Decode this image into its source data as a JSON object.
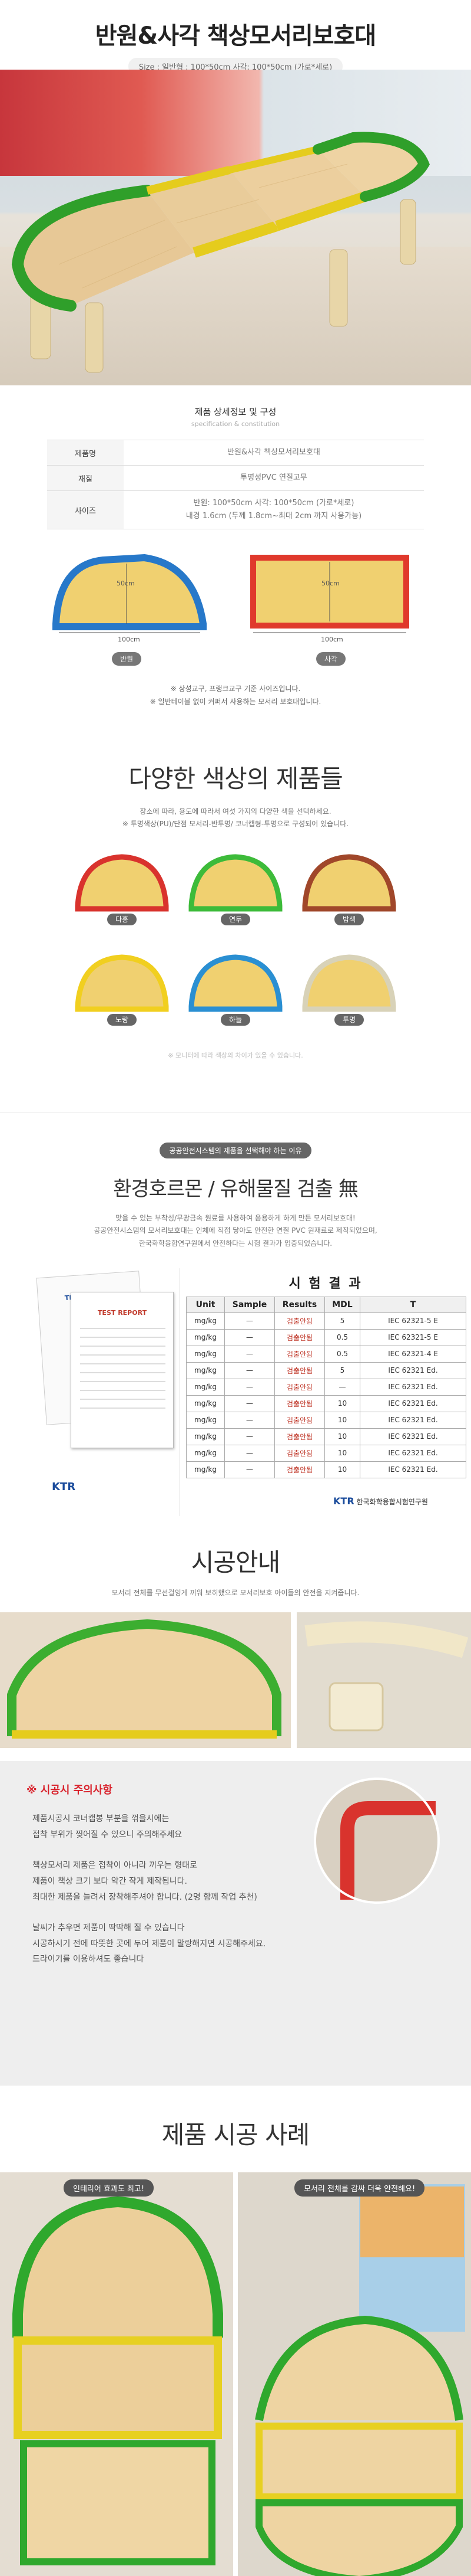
{
  "header": {
    "title": "반원&사각 책상모서리보호대",
    "size_note": "Size : 일반형 : 100*50cm 사각: 100*50cm (가로*세로)"
  },
  "spec": {
    "title": "제품 상세정보 및 구성",
    "subtitle": "specification & constitution",
    "rows": [
      {
        "key": "제품명",
        "value": "반원&사각 책상모서리보호대"
      },
      {
        "key": "재질",
        "value": "투명성PVC 연질고무"
      },
      {
        "key": "사이즈",
        "value": "반원: 100*50cm 사각: 100*50cm (가로*세로)",
        "value2": "내경 1.6cm (두께 1.8cm~최대 2cm 까지 사용가능)"
      }
    ],
    "dim_half_width": "100cm",
    "dim_half_height": "50cm",
    "dim_rect_width": "100cm",
    "dim_rect_height": "50cm",
    "label_half": "반원",
    "label_rect": "사각",
    "notes": [
      "※ 상성교구, 프랭크교구 기준 사이즈입니다.",
      "※ 일반테이블 없이 커퍼서 사용하는 모서리 보호대입니다."
    ]
  },
  "colors": {
    "heading": "다양한 색상의 제품들",
    "desc": [
      "장소에 따라, 용도에 따라서 여섯 가지의 다양한 색을 선택하세요.",
      "※ 투명색상(PU)/단점 모서리-반투명/ 코너캡형-투명으로 구성되어 있습니다."
    ],
    "items": [
      {
        "label": "다홍",
        "color": "#d9332d"
      },
      {
        "label": "연두",
        "color": "#3dbb3a"
      },
      {
        "label": "밤색",
        "color": "#a0472a"
      },
      {
        "label": "노랑",
        "color": "#f1cf1f"
      },
      {
        "label": "하늘",
        "color": "#2a8fd2"
      },
      {
        "label": "투명",
        "color": "#d8d2b8"
      }
    ],
    "foot": "※ 모니터에 따라 색상의 차이가 있을 수 있습니다."
  },
  "cert": {
    "pill": "공공안전시스템의 제품을 선택해야 하는 이유",
    "heading": "환경호르몬 / 유해물질 검출 無",
    "desc": [
      "맞을 수 있는 부착성/무광금속 원료를 사용하여 음용하게 하게 만든 모서리보호대!",
      "공공안전시스템의 모서리보호대는 인체에 직접 닿아도 안전한 연질 PVC 원재료로 제작되었으며,",
      "한국화학융합연구원에서 안전하다는 시험 결과가 입증되었습니다."
    ],
    "doc_title": "TEST REPORT",
    "doc_title2": "TEST REPORT",
    "ktr": "KTR",
    "ktr_org": "한국화학융합시험연구원",
    "report_title": "시 험 결 과",
    "columns": [
      "Unit",
      "Sample",
      "Results",
      "MDL",
      "T"
    ],
    "rows": [
      [
        "mg/kg",
        "—",
        "검출안됨",
        "5",
        "IEC 62321-5 E"
      ],
      [
        "mg/kg",
        "—",
        "검출안됨",
        "0.5",
        "IEC 62321-5 E"
      ],
      [
        "mg/kg",
        "—",
        "검출안됨",
        "0.5",
        "IEC 62321-4 E"
      ],
      [
        "mg/kg",
        "—",
        "검출안됨",
        "5",
        "IEC 62321 Ed."
      ],
      [
        "mg/kg",
        "—",
        "검출안됨",
        "—",
        "IEC 62321 Ed."
      ],
      [
        "mg/kg",
        "—",
        "검출안됨",
        "10",
        "IEC 62321 Ed."
      ],
      [
        "mg/kg",
        "—",
        "검출안됨",
        "10",
        "IEC 62321 Ed."
      ],
      [
        "mg/kg",
        "—",
        "검출안됨",
        "10",
        "IEC 62321 Ed."
      ],
      [
        "mg/kg",
        "—",
        "검출안됨",
        "10",
        "IEC 62321 Ed."
      ],
      [
        "mg/kg",
        "—",
        "검출안됨",
        "10",
        "IEC 62321 Ed."
      ]
    ]
  },
  "install": {
    "heading": "시공안내",
    "desc": "모서리 전체를 무선걸잉게 끼워 보히했으로 모서리보호 아이들의 안전을 지켜줍니다.",
    "caution_title": "※ 시공시 주의사항",
    "caution_lines": [
      "제품시공시 코너캡봉 부분을 꺾을시에는",
      "접착 부위가 찢어질 수 있으니 주의해주세요",
      "",
      "책상모서리 제품은 접착이 아니라 끼우는 형태로",
      "제품이 책상 크기 보다 약간 작게 제작됩니다.",
      "최대한 제품을 늘려서 장착해주셔야 합니다. (2명 함께 작업 추천)",
      "",
      "날씨가 추우면 제품이 딱딱해 질 수 있습니다",
      "시공하시기 전에 따뜻한 곳에 두어 제품이 말랑해지면 시공해주세요.",
      "드라이기를 이용하셔도 좋습니다"
    ]
  },
  "cases": {
    "heading": "제품 시공 사례",
    "caption_left": "인테리어 효과도 최고!",
    "caption_right": "모서리 전체를 감싸 더욱 안전해요!"
  }
}
